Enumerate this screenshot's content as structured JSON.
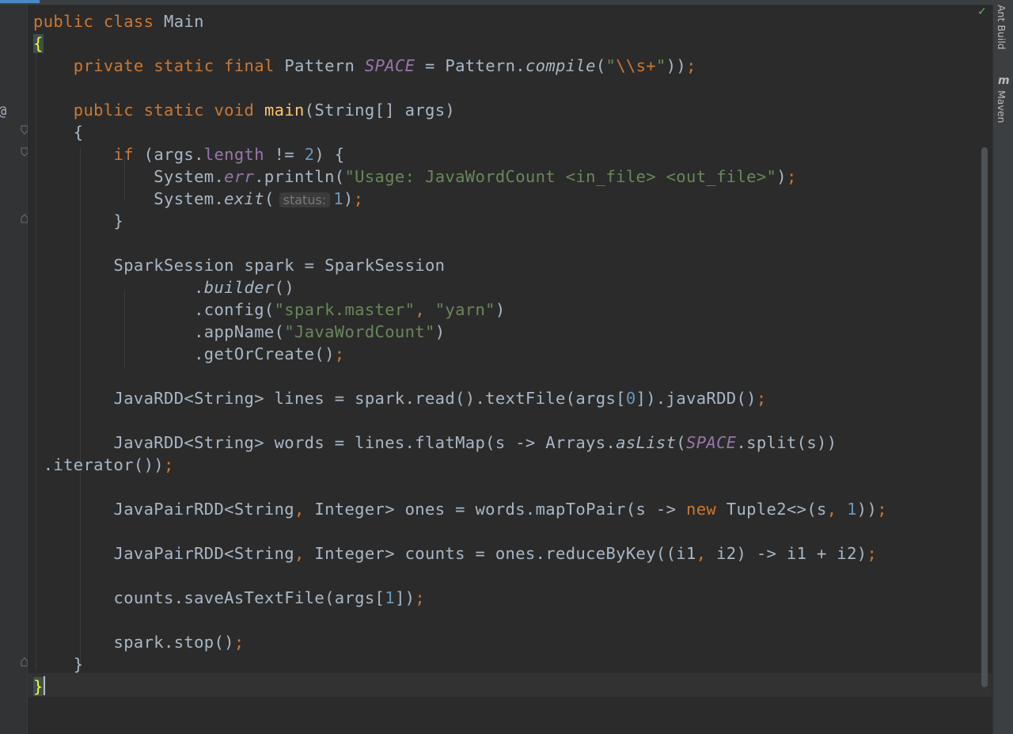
{
  "editor": {
    "gutter_marker": "@",
    "param_hint": "status:",
    "inspection_status": "✓",
    "code_lines": [
      [
        [
          "kw",
          "public class "
        ],
        [
          "",
          "Main"
        ]
      ],
      [
        [
          "brace",
          "{"
        ]
      ],
      [
        [
          "",
          "    "
        ],
        [
          "kw",
          "private static final "
        ],
        [
          "",
          "Pattern "
        ],
        [
          "fldi",
          "SPACE"
        ],
        [
          "",
          " = Pattern."
        ],
        [
          "it",
          "compile"
        ],
        [
          "",
          "("
        ],
        [
          "str",
          "\""
        ],
        [
          "esc",
          "\\\\s+"
        ],
        [
          "str",
          "\""
        ],
        [
          "",
          "))"
        ],
        [
          "kw",
          ";"
        ]
      ],
      [],
      [
        [
          "",
          "    "
        ],
        [
          "kw",
          "public static void "
        ],
        [
          "fn",
          "main"
        ],
        [
          "",
          "(String[] args)"
        ]
      ],
      [
        [
          "",
          "    {"
        ]
      ],
      [
        [
          "",
          "        "
        ],
        [
          "kw",
          "if "
        ],
        [
          "",
          "(args."
        ],
        [
          "fld",
          "length"
        ],
        [
          "",
          " != "
        ],
        [
          "num",
          "2"
        ],
        [
          "",
          ") {"
        ]
      ],
      [
        [
          "",
          "            System."
        ],
        [
          "fldi",
          "err"
        ],
        [
          "",
          ".println("
        ],
        [
          "str",
          "\"Usage: JavaWordCount <in_file> <out_file>\""
        ],
        [
          "",
          ")"
        ],
        [
          "kw",
          ";"
        ]
      ],
      [
        [
          "",
          "            System."
        ],
        [
          "it",
          "exit"
        ],
        [
          "",
          "("
        ],
        [
          "hint",
          "status:"
        ],
        [
          "num",
          "1"
        ],
        [
          "",
          ")"
        ],
        [
          "kw",
          ";"
        ]
      ],
      [
        [
          "",
          "        }"
        ]
      ],
      [],
      [
        [
          "",
          "        SparkSession spark = SparkSession"
        ]
      ],
      [
        [
          "",
          "                ."
        ],
        [
          "it",
          "builder"
        ],
        [
          "",
          "()"
        ]
      ],
      [
        [
          "",
          "                .config("
        ],
        [
          "str",
          "\"spark.master\""
        ],
        [
          "kw",
          ", "
        ],
        [
          "str",
          "\"yarn\""
        ],
        [
          "",
          ")"
        ]
      ],
      [
        [
          "",
          "                .appName("
        ],
        [
          "str",
          "\"JavaWordCount\""
        ],
        [
          "",
          ")"
        ]
      ],
      [
        [
          "",
          "                .getOrCreate()"
        ],
        [
          "kw",
          ";"
        ]
      ],
      [],
      [
        [
          "",
          "        JavaRDD<String> lines = spark.read().textFile(args["
        ],
        [
          "num",
          "0"
        ],
        [
          "",
          "]).javaRDD()"
        ],
        [
          "kw",
          ";"
        ]
      ],
      [],
      [
        [
          "",
          "        JavaRDD<String> words = lines.flatMap(s -> Arrays."
        ],
        [
          "it",
          "asList"
        ],
        [
          "",
          "("
        ],
        [
          "fldi",
          "SPACE"
        ],
        [
          "",
          ".split(s))"
        ]
      ],
      [
        [
          "",
          " .iterator())"
        ],
        [
          "kw",
          ";"
        ]
      ],
      [],
      [
        [
          "",
          "        JavaPairRDD<String"
        ],
        [
          "kw",
          ", "
        ],
        [
          "",
          "Integer> ones = words.mapToPair(s -> "
        ],
        [
          "kw",
          "new "
        ],
        [
          "",
          "Tuple2<>(s"
        ],
        [
          "kw",
          ", "
        ],
        [
          "num",
          "1"
        ],
        [
          "",
          "))"
        ],
        [
          "kw",
          ";"
        ]
      ],
      [],
      [
        [
          "",
          "        JavaPairRDD<String"
        ],
        [
          "kw",
          ", "
        ],
        [
          "",
          "Integer> counts = ones.reduceByKey((i1"
        ],
        [
          "kw",
          ", "
        ],
        [
          "",
          "i2) -> i1 + i2)"
        ],
        [
          "kw",
          ";"
        ]
      ],
      [],
      [
        [
          "",
          "        counts.saveAsTextFile(args["
        ],
        [
          "num",
          "1"
        ],
        [
          "",
          "])"
        ],
        [
          "kw",
          ";"
        ]
      ],
      [],
      [
        [
          "",
          "        spark.stop()"
        ],
        [
          "kw",
          ";"
        ]
      ],
      [
        [
          "",
          "    }"
        ]
      ],
      [
        [
          "brace",
          "}"
        ],
        [
          "caret",
          ""
        ]
      ]
    ]
  },
  "right_toolbar": {
    "ant_build_label": "Ant Build",
    "maven_icon_label": "m",
    "maven_label": "Maven"
  },
  "colors": {
    "background": "#2b2b2b",
    "keyword": "#cc7832",
    "string": "#6a8759",
    "number": "#6897bb",
    "field": "#9876aa",
    "method_decl": "#ffc66d",
    "plain": "#a9b7c6"
  }
}
